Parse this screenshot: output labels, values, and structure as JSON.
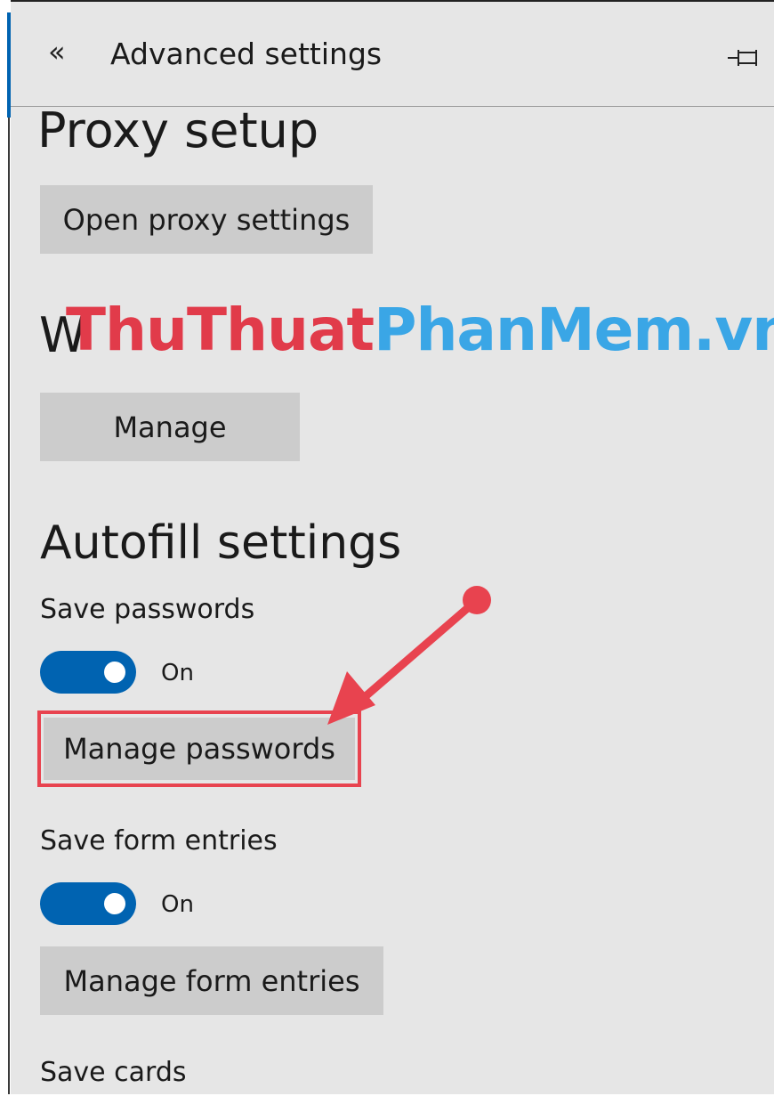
{
  "header": {
    "back_icon": "«",
    "title": "Advanced settings",
    "pin_icon": "pin-icon"
  },
  "proxy": {
    "heading": "Proxy setup",
    "button": "Open proxy settings"
  },
  "website_permissions": {
    "heading_partial": "W",
    "button": "Manage"
  },
  "watermark": {
    "part1": "ThuThuat",
    "part2": "PhanMem.vn",
    "color1": "#e13b4a",
    "color2": "#3aa6e6"
  },
  "autofill": {
    "heading": "Autofill settings",
    "save_passwords_label": "Save passwords",
    "save_passwords_state": "On",
    "manage_passwords_button": "Manage passwords",
    "save_form_entries_label": "Save form entries",
    "save_form_entries_state": "On",
    "manage_form_entries_button": "Manage form entries",
    "save_cards_label": "Save cards"
  },
  "colors": {
    "accent": "#0063b1",
    "annotation": "#e8434f",
    "panel_bg": "#e6e6e6",
    "button_bg": "#cccccc"
  }
}
